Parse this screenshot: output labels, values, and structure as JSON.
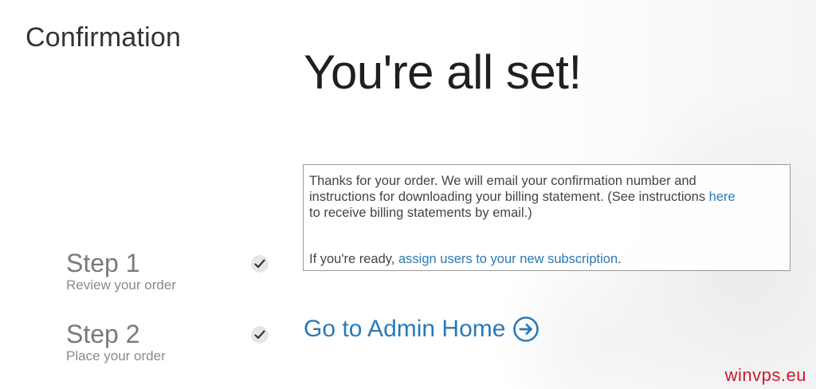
{
  "page": {
    "heading": "Confirmation",
    "title": "You're all set!"
  },
  "info": {
    "line1": "Thanks for your order. We will email your confirmation number and",
    "line2_prefix": "instructions for downloading your billing statement. (See instructions ",
    "line2_link": "here",
    "line3": "to receive billing statements by email.)",
    "ready_prefix": "If you're ready, ",
    "ready_link": "assign users to your new subscription",
    "ready_suffix": "."
  },
  "steps": [
    {
      "title": "Step 1",
      "subtitle": "Review your order",
      "done": true
    },
    {
      "title": "Step 2",
      "subtitle": "Place your order",
      "done": true
    }
  ],
  "admin_link": {
    "label": "Go to Admin Home",
    "icon": "arrow-right-circle-icon"
  },
  "watermark": "winvps.eu",
  "colors": {
    "link": "#2a7ab7",
    "watermark": "#d1182b"
  }
}
